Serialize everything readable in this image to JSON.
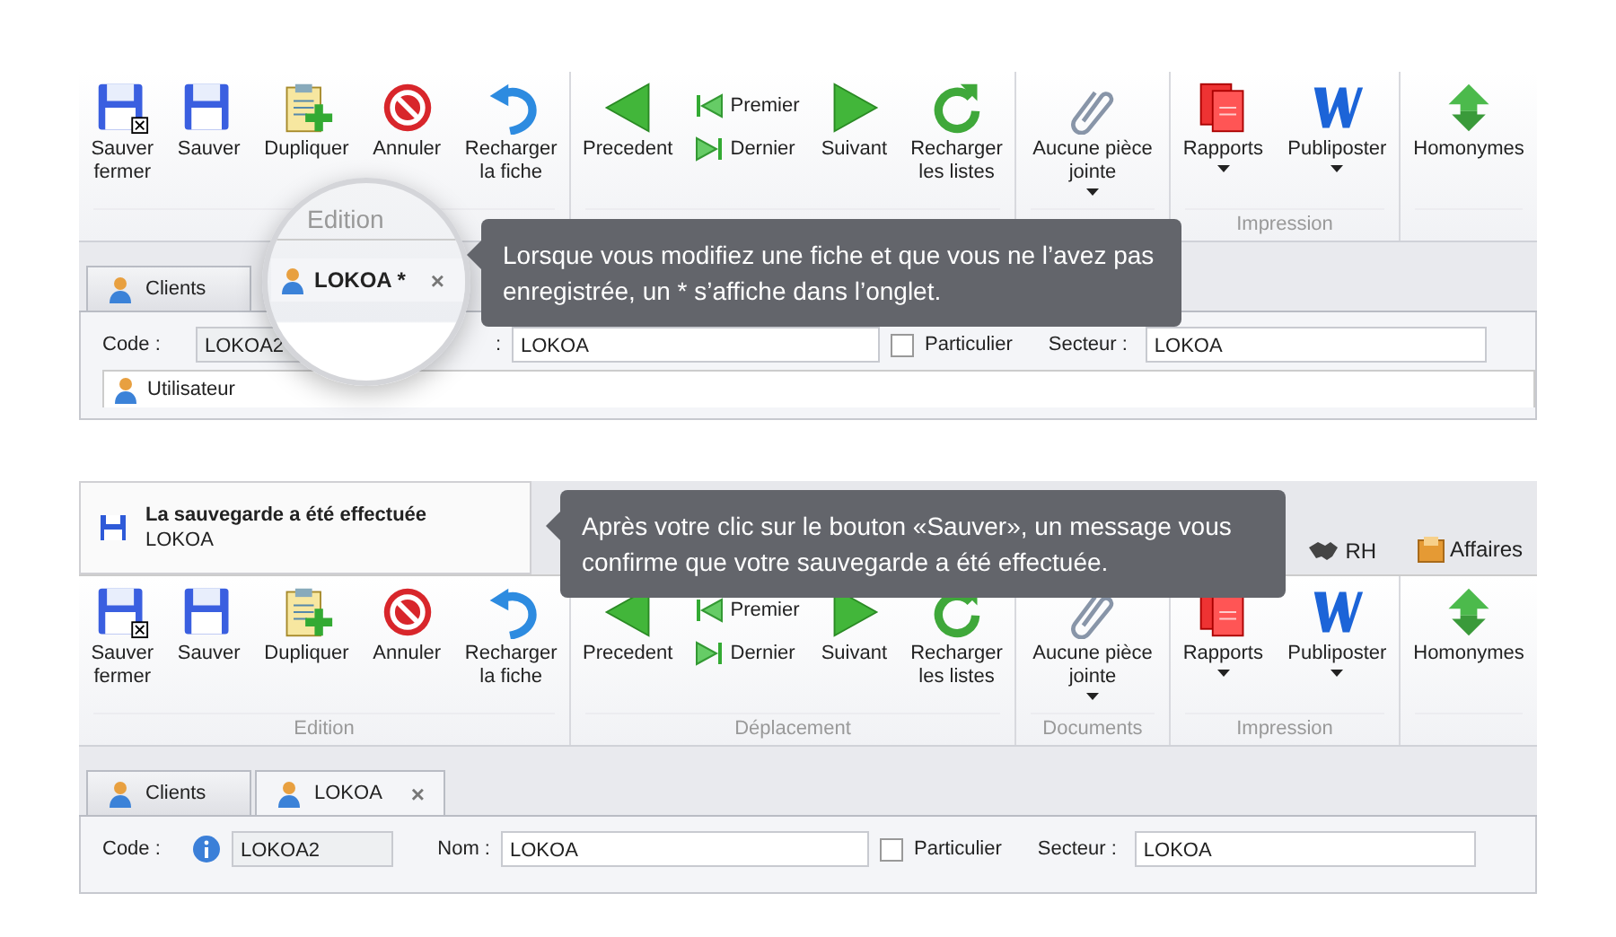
{
  "first_view": {
    "ribbon": {
      "groups": [
        {
          "items": [
            {
              "kind": "floppyclose",
              "label": "Sauver\nfermer"
            },
            {
              "kind": "floppy",
              "label": "Sauver"
            },
            {
              "kind": "clipboard",
              "label": "Dupliquer"
            },
            {
              "kind": "forbid",
              "label": "Annuler"
            },
            {
              "kind": "undo",
              "label": "Recharger\nla fiche"
            }
          ]
        },
        {
          "items": [
            {
              "kind": "back",
              "label": "Precedent"
            },
            {
              "kind": "pair",
              "items": [
                {
                  "kind": "first",
                  "label": "Premier"
                },
                {
                  "kind": "last",
                  "label": "Dernier"
                }
              ]
            },
            {
              "kind": "forward",
              "label": "Suivant"
            },
            {
              "kind": "refresh",
              "label": "Recharger\nles listes"
            }
          ]
        },
        {
          "items": [
            {
              "kind": "paperclip",
              "label": "Aucune pièce\njointe",
              "dropdown": true
            }
          ]
        },
        {
          "label": "Impression",
          "items": [
            {
              "kind": "reports",
              "label": "Rapports",
              "dropdown": true
            },
            {
              "kind": "letter",
              "label": "Publiposter",
              "dropdown": true
            }
          ]
        },
        {
          "items": [
            {
              "kind": "arrows",
              "label": "Homonymes"
            }
          ]
        }
      ]
    },
    "tabs": [
      {
        "label": "Clients",
        "selected": false
      }
    ],
    "form": {
      "code_label": "Code :",
      "code_value": "LOKOA2",
      "name_label": ":",
      "name_value": "LOKOA",
      "particulier": {
        "label": "Particulier",
        "checked": false
      },
      "secteur_label": "Secteur :",
      "secteur_value": "LOKOA"
    },
    "user_row": "Utilisateur",
    "magnifier": {
      "group_label": "Edition",
      "tab": {
        "label": "LOKOA *",
        "selected": true,
        "close": "×"
      }
    },
    "tooltip": "Lorsque vous modifiez une fiche et que vous ne l’avez pas enregistrée, un * s’affiche dans l’onglet."
  },
  "second_view": {
    "notification": {
      "title": "La sauvegarde a été effectuée",
      "subtitle": "LOKOA"
    },
    "header_tabs": [
      {
        "kind": "handshake",
        "label": "RH"
      },
      {
        "kind": "folder",
        "label": "Affaires"
      }
    ],
    "ribbon": {
      "groups": [
        {
          "label": "Edition",
          "items": [
            {
              "kind": "floppyclose",
              "label": "Sauver\nfermer"
            },
            {
              "kind": "floppy",
              "label": "Sauver"
            },
            {
              "kind": "clipboard",
              "label": "Dupliquer"
            },
            {
              "kind": "forbid",
              "label": "Annuler"
            },
            {
              "kind": "undo",
              "label": "Recharger\nla fiche"
            }
          ]
        },
        {
          "label": "Déplacement",
          "items": [
            {
              "kind": "back",
              "label": "Precedent"
            },
            {
              "kind": "pair",
              "items": [
                {
                  "kind": "first",
                  "label": "Premier"
                },
                {
                  "kind": "last",
                  "label": "Dernier"
                }
              ]
            },
            {
              "kind": "forward",
              "label": "Suivant"
            },
            {
              "kind": "refresh",
              "label": "Recharger\nles listes"
            }
          ]
        },
        {
          "label": "Documents",
          "items": [
            {
              "kind": "paperclip",
              "label": "Aucune pièce\njointe",
              "dropdown": true
            }
          ]
        },
        {
          "label": "Impression",
          "items": [
            {
              "kind": "reports",
              "label": "Rapports",
              "dropdown": true
            },
            {
              "kind": "letter",
              "label": "Publiposter",
              "dropdown": true
            }
          ]
        },
        {
          "items": [
            {
              "kind": "arrows",
              "label": "Homonymes"
            }
          ]
        }
      ]
    },
    "tabs": [
      {
        "label": "Clients",
        "selected": false
      },
      {
        "label": "LOKOA",
        "selected": true,
        "close": "×"
      }
    ],
    "form": {
      "code_label": "Code :",
      "info": true,
      "code_value": "LOKOA2",
      "name_label": "Nom :",
      "name_value": "LOKOA",
      "particulier": {
        "label": "Particulier",
        "checked": false
      },
      "secteur_label": "Secteur :",
      "secteur_value": "LOKOA"
    },
    "tooltip": "Après votre clic sur le bouton «Sauver», un message vous confirme que votre sauvegarde a été effectuée."
  }
}
